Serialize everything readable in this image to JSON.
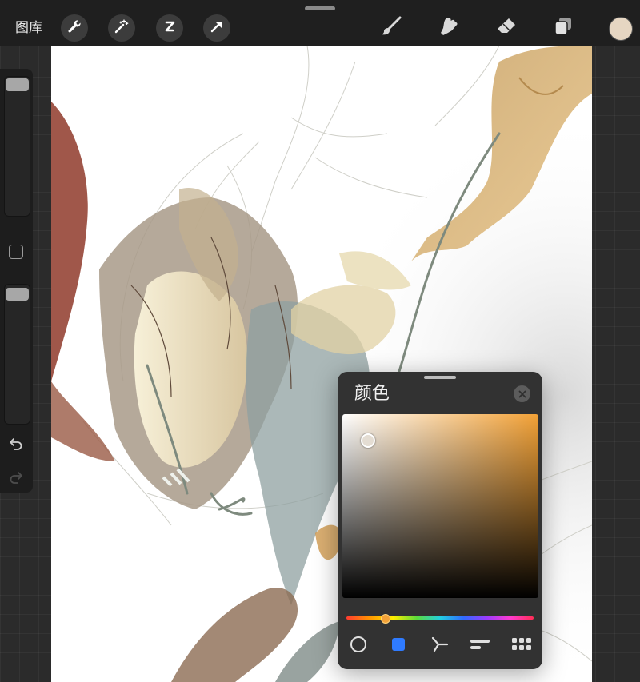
{
  "topbar": {
    "gallery_label": "图库",
    "current_color": "#e6d6c2"
  },
  "color_panel": {
    "title": "颜色",
    "hue_color": "#f2a136",
    "selected_color": "#e4ddd3",
    "hue_position": 0.08,
    "active_tab": "disc"
  },
  "icons": {
    "actions": "wrench-icon",
    "adjustments": "magic-wand-icon",
    "selection": "selection-s-icon",
    "transform": "arrow-cursor-icon",
    "brush": "brush-icon",
    "smudge": "smudge-finger-icon",
    "eraser": "eraser-icon",
    "layers": "layers-icon"
  },
  "colors": {
    "accent_blue": "#2f7bff",
    "toolbar_bg": "#1f1f1f",
    "panel_bg": "#323232"
  }
}
